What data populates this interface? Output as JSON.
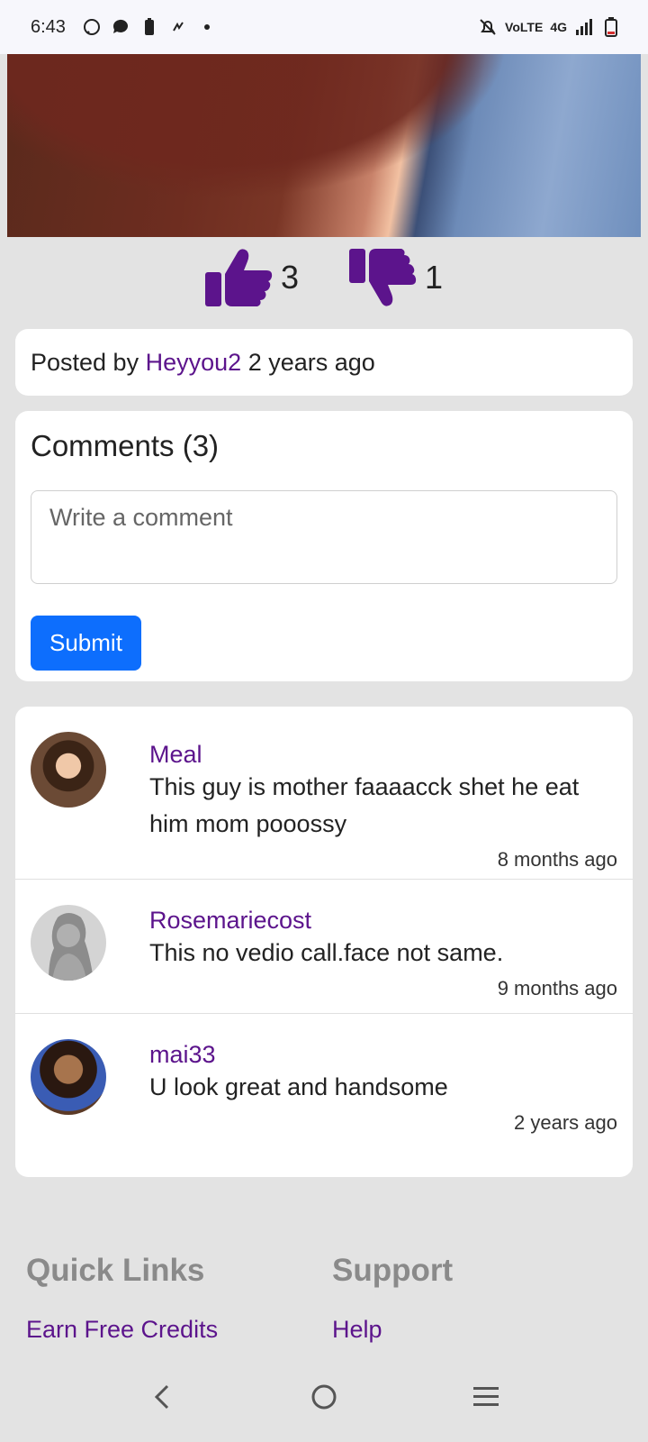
{
  "status_bar": {
    "time": "6:43",
    "network": "4G",
    "volte": "VoLTE"
  },
  "votes": {
    "likes": "3",
    "dislikes": "1"
  },
  "post": {
    "posted_by_prefix": "Posted by",
    "author": "Heyyou2",
    "age": "2 years ago"
  },
  "comments": {
    "title": "Comments (3)",
    "input_placeholder": "Write a comment",
    "submit_label": "Submit",
    "items": [
      {
        "name": "Meal",
        "text": "This guy is mother faaaacck shet he eat him mom pooossy",
        "time": "8 months ago"
      },
      {
        "name": "Rosemariecost",
        "text": "This no vedio call.face not same.",
        "time": "9 months ago"
      },
      {
        "name": "mai33",
        "text": "U look great and handsome",
        "time": "2 years ago"
      }
    ]
  },
  "footer": {
    "quick_links_title": "Quick Links",
    "quick_links_item": "Earn Free Credits",
    "support_title": "Support",
    "support_item": "Help"
  },
  "colors": {
    "accent": "#5c148c",
    "button": "#0d6efd",
    "background": "#e3e3e3"
  }
}
